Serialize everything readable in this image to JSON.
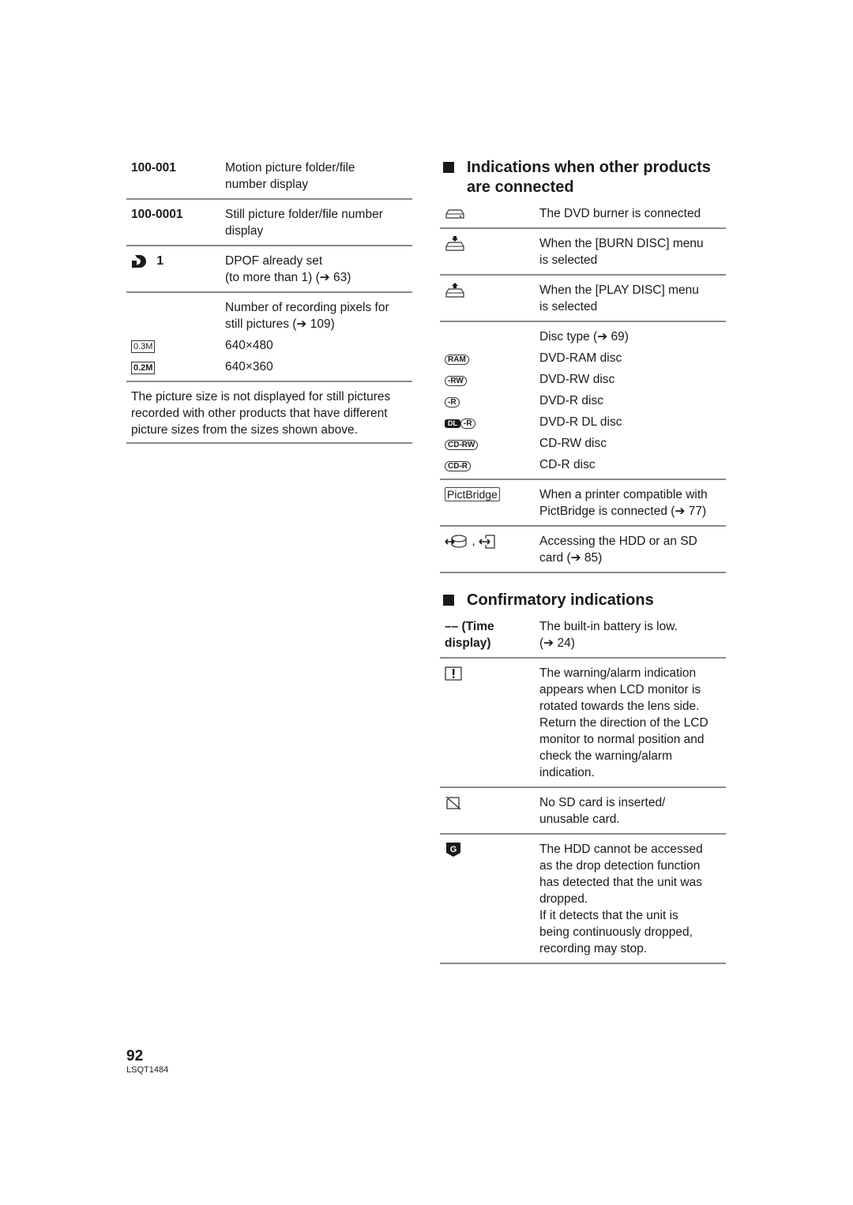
{
  "left": {
    "rows": [
      {
        "key": "100-001",
        "desc": [
          "Motion picture folder/file",
          "number display"
        ]
      },
      {
        "key": "100-0001",
        "desc": [
          "Still picture folder/file number",
          "display"
        ]
      },
      {
        "key": "1",
        "icon": "dpof-icon",
        "desc": [
          "DPOF already set",
          "(to more than 1) (➔ 63)"
        ]
      },
      {
        "key": "",
        "desc": [
          "Number of recording pixels for",
          "still pictures (➔ 109)"
        ]
      },
      {
        "icon_label": "0.3M",
        "desc": [
          "640×480"
        ]
      },
      {
        "icon_label": "0.2M",
        "desc": [
          "640×360"
        ]
      }
    ],
    "note": "The picture size is not displayed for still pictures recorded with other products that have different picture sizes from the sizes shown above."
  },
  "right": {
    "section1_title": "Indications when other products are connected",
    "section1_rows": [
      {
        "icon": "dvd-burner-icon",
        "desc": [
          "The DVD burner is connected"
        ]
      },
      {
        "icon": "burn-disc-icon",
        "desc": [
          "When the [BURN DISC] menu",
          "is selected"
        ]
      },
      {
        "icon": "play-disc-icon",
        "desc": [
          "When the [PLAY DISC] menu",
          "is selected"
        ]
      },
      {
        "icon": "",
        "desc": [
          "Disc type (➔ 69)"
        ]
      },
      {
        "icon_label": "RAM",
        "desc": [
          "DVD-RAM disc"
        ]
      },
      {
        "icon_label": "-RW",
        "desc": [
          "DVD-RW disc"
        ]
      },
      {
        "icon_label": "-R",
        "desc": [
          "DVD-R disc"
        ]
      },
      {
        "icon_label": "-R",
        "dl_label": "DL",
        "desc": [
          "DVD-R DL disc"
        ]
      },
      {
        "icon_label": "CD-RW",
        "desc": [
          "CD-RW disc"
        ]
      },
      {
        "icon_label": "CD-R",
        "desc": [
          "CD-R disc"
        ]
      },
      {
        "icon_label": "PictBridge",
        "desc": [
          "When a printer compatible with",
          "PictBridge is connected (➔ 77)"
        ]
      },
      {
        "icon": "hdd-sd-access-icon",
        "desc": [
          "Accessing the HDD or an SD",
          "card (➔ 85)"
        ]
      }
    ],
    "section2_title": "Confirmatory indications",
    "section2_rows": [
      {
        "key": [
          "–– (Time",
          "display)"
        ],
        "desc": [
          "The built-in battery is low.",
          "(➔ 24)"
        ]
      },
      {
        "icon": "warning-icon",
        "desc": [
          "The warning/alarm indication",
          "appears when LCD monitor is",
          "rotated towards the lens side.",
          "Return the direction of the LCD",
          "monitor to normal position and",
          "check the warning/alarm",
          "indication."
        ]
      },
      {
        "icon": "no-sd-card-icon",
        "desc": [
          "No SD card is inserted/",
          "unusable card."
        ]
      },
      {
        "icon": "drop-detection-icon",
        "icon_label": "G",
        "desc": [
          "The HDD cannot be accessed",
          "as the drop detection function",
          "has detected that the unit was",
          "dropped.",
          "If it detects that the unit is",
          "being continuously dropped,",
          "recording may stop."
        ]
      }
    ]
  },
  "footer": {
    "page_number": "92",
    "model_code": "LSQT1484"
  }
}
